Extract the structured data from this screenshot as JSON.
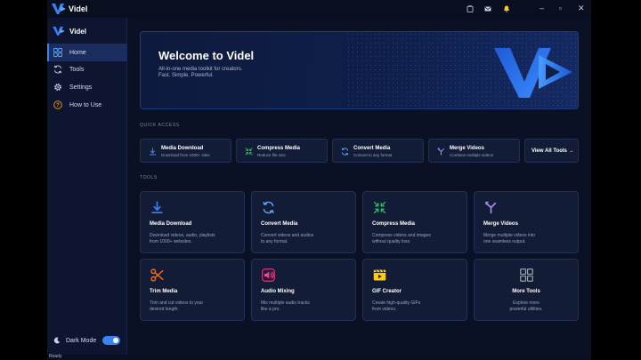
{
  "app": {
    "title": "Videl"
  },
  "titlebar": {
    "minimize": "–",
    "maximize": "▫",
    "close": "✕"
  },
  "sidebar": {
    "brand": "Videl",
    "items": [
      {
        "label": "Home",
        "icon": "grid-icon",
        "active": true
      },
      {
        "label": "Tools",
        "icon": "refresh-icon",
        "active": false
      },
      {
        "label": "Settings",
        "icon": "gear-icon",
        "active": false
      },
      {
        "label": "How to Use",
        "icon": "help-icon",
        "active": false
      }
    ],
    "dark_mode": {
      "label": "Dark Mode",
      "on": true
    }
  },
  "hero": {
    "title": "Welcome to Videl",
    "subtitle_1": "All-in-one media toolkit for creators.",
    "subtitle_2": "Fast. Simple. Powerful."
  },
  "quick_access": {
    "label": "QUICK ACCESS",
    "items": [
      {
        "title": "Media Download",
        "desc": "Download from 1000+ sites",
        "icon": "download-icon",
        "color": "#3b82f6"
      },
      {
        "title": "Compress Media",
        "desc": "Reduce file size",
        "icon": "compress-icon",
        "color": "#22c55e"
      },
      {
        "title": "Convert Media",
        "desc": "Convert to any format",
        "icon": "convert-icon",
        "color": "#60a5fa"
      },
      {
        "title": "Merge Videos",
        "desc": "Combine multiple videos",
        "icon": "merge-icon",
        "color": "#a78bfa"
      }
    ],
    "view_all": "View All Tools  →"
  },
  "tools": {
    "label": "TOOLS",
    "items": [
      {
        "title": "Media Download",
        "d1": "Download videos, audio, playlists",
        "d2": "from 1000+ websites.",
        "icon": "download-icon",
        "color": "#3b82f6"
      },
      {
        "title": "Convert Media",
        "d1": "Convert videos and audios",
        "d2": "to any format.",
        "icon": "convert-icon",
        "color": "#60a5fa"
      },
      {
        "title": "Compress Media",
        "d1": "Compress videos and images",
        "d2": "without quality loss.",
        "icon": "compress-icon",
        "color": "#22c55e"
      },
      {
        "title": "Merge Videos",
        "d1": "Merge multiple videos into",
        "d2": "one seamless output.",
        "icon": "merge-icon",
        "color": "#a78bfa"
      },
      {
        "title": "Trim Media",
        "d1": "Trim and cut videos to your",
        "d2": "desired length.",
        "icon": "scissors-icon",
        "color": "#f97316"
      },
      {
        "title": "Audio Mixing",
        "d1": "Mix multiple audio tracks",
        "d2": "like a pro.",
        "icon": "speaker-icon",
        "color": "#ec4899"
      },
      {
        "title": "GIF Creator",
        "d1": "Create high-quality GIFs",
        "d2": "from videos.",
        "icon": "gif-icon",
        "color": "#facc15"
      },
      {
        "title": "More Tools",
        "d1": "Explore more",
        "d2": "powerful utilities.",
        "icon": "apps-icon",
        "color": "#9ca3af"
      }
    ]
  },
  "status": {
    "text": "Ready"
  }
}
